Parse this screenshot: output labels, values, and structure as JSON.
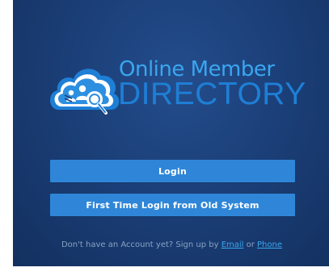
{
  "logo": {
    "line1": "Online Member",
    "line2": "DIRECTORY",
    "icon": "cloud-search-people-icon"
  },
  "buttons": {
    "login": "Login",
    "old_system": "First Time Login from Old System"
  },
  "signup": {
    "prefix": "Don't have an Account yet? Sign up by ",
    "email": "Email",
    "or": " or ",
    "phone": "Phone"
  },
  "colors": {
    "panel_bg": "#1b3f78",
    "button": "#2f86d8",
    "accent": "#3aa6f0",
    "muted_text": "#8aa3c4"
  }
}
